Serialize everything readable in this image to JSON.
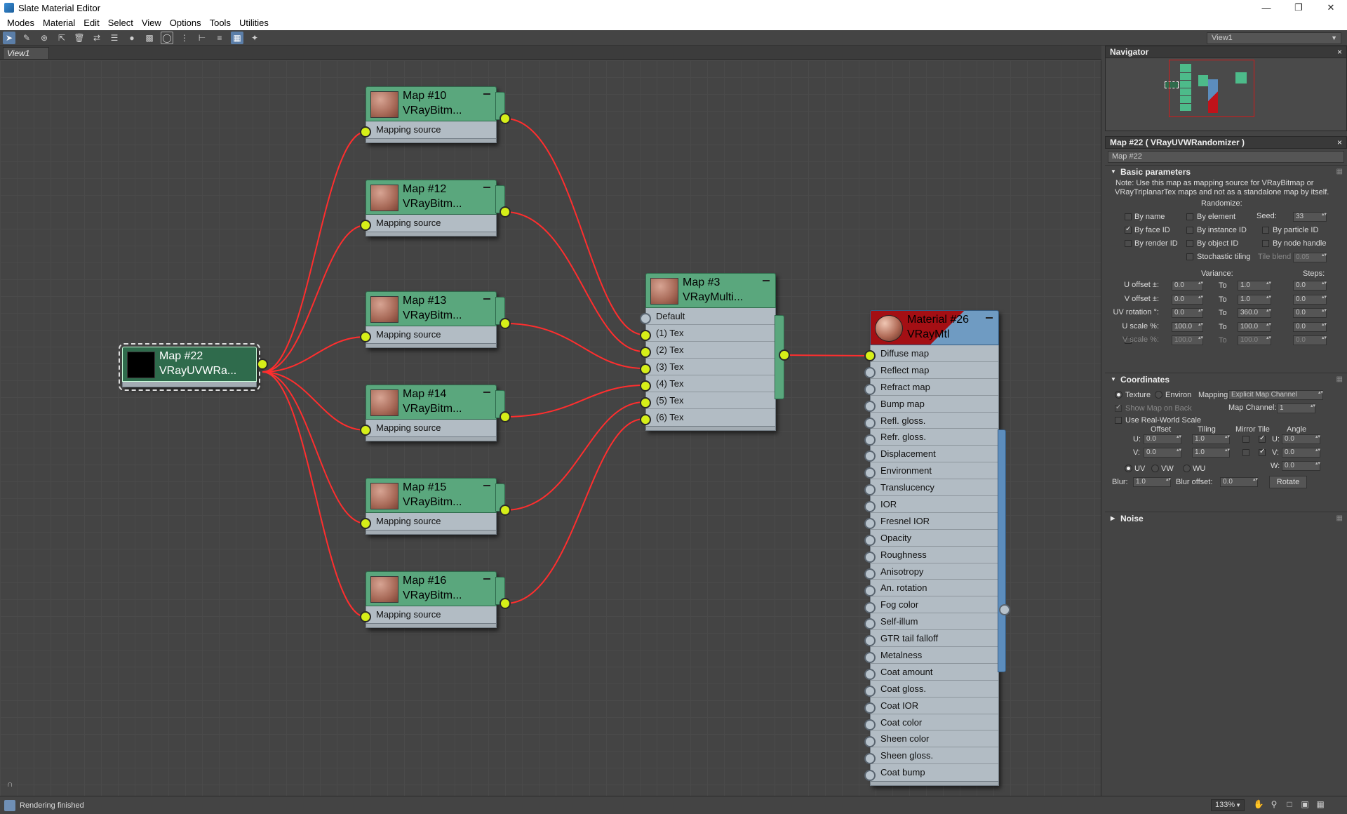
{
  "app": {
    "title": "Slate Material Editor"
  },
  "menu": [
    "Modes",
    "Material",
    "Edit",
    "Select",
    "View",
    "Options",
    "Tools",
    "Utilities"
  ],
  "view_select": "View1",
  "view_tab": "View1",
  "nodes": {
    "map22": {
      "name": "Map #22",
      "type": "VRayUVWRa...",
      "slots": []
    },
    "map10": {
      "name": "Map #10",
      "type": "VRayBitm...",
      "slots": [
        "Mapping source"
      ]
    },
    "map12": {
      "name": "Map #12",
      "type": "VRayBitm...",
      "slots": [
        "Mapping source"
      ]
    },
    "map13": {
      "name": "Map #13",
      "type": "VRayBitm...",
      "slots": [
        "Mapping source"
      ]
    },
    "map14": {
      "name": "Map #14",
      "type": "VRayBitm...",
      "slots": [
        "Mapping source"
      ]
    },
    "map15": {
      "name": "Map #15",
      "type": "VRayBitm...",
      "slots": [
        "Mapping source"
      ]
    },
    "map16": {
      "name": "Map #16",
      "type": "VRayBitm...",
      "slots": [
        "Mapping source"
      ]
    },
    "map3": {
      "name": "Map #3",
      "type": "VRayMulti...",
      "slots": [
        "Default",
        "(1) Tex",
        "(2) Tex",
        "(3) Tex",
        "(4) Tex",
        "(5) Tex",
        "(6) Tex"
      ]
    },
    "mat26": {
      "name": "Material #26",
      "type": "VRayMtl",
      "slots": [
        "Diffuse map",
        "Reflect map",
        "Refract map",
        "Bump map",
        "Refl. gloss.",
        "Refr. gloss.",
        "Displacement",
        "Environment",
        "Translucency",
        "IOR",
        "Fresnel IOR",
        "Opacity",
        "Roughness",
        "Anisotropy",
        "An. rotation",
        "Fog color",
        "Self-illum",
        "GTR tail falloff",
        "Metalness",
        "Coat amount",
        "Coat gloss.",
        "Coat IOR",
        "Coat color",
        "Sheen color",
        "Sheen gloss.",
        "Coat bump"
      ]
    }
  },
  "navigator": {
    "title": "Navigator"
  },
  "params": {
    "header": "Map #22  ( VRayUVWRandomizer )",
    "name_field": "Map #22",
    "basic_title": "Basic parameters",
    "note1": "Note: Use this map as mapping source for VRayBitmap or",
    "note2": "VRayTriplanarTex maps and not as a standalone map by itself.",
    "randomize": "Randomize:",
    "by_name": "By name",
    "by_element": "By element",
    "seed_label": "Seed:",
    "seed": "33",
    "by_face": "By face ID",
    "by_instance": "By instance ID",
    "by_particle": "By particle ID",
    "by_render": "By render ID",
    "by_object": "By object ID",
    "by_node": "By node handle",
    "stochastic": "Stochastic tiling",
    "tile_blend": "Tile blend",
    "tile_blend_val": "0.05",
    "variance": "Variance:",
    "steps": "Steps:",
    "to": "To",
    "rows": [
      {
        "label": "U offset ±:",
        "v": "0.0",
        "to": "1.0",
        "s": "0.0"
      },
      {
        "label": "V offset ±:",
        "v": "0.0",
        "to": "1.0",
        "s": "0.0"
      },
      {
        "label": "UV rotation °:",
        "v": "0.0",
        "to": "360.0",
        "s": "0.0"
      },
      {
        "label": "U scale %:",
        "v": "100.0",
        "to": "100.0",
        "s": "0.0"
      },
      {
        "label": "V scale %:",
        "v": "100.0",
        "to": "100.0",
        "s": "0.0"
      }
    ],
    "coords_title": "Coordinates",
    "texture": "Texture",
    "environ": "Environ",
    "mapping_label": "Mapping:",
    "mapping_val": "Explicit Map Channel",
    "show_map": "Show Map on Back",
    "map_channel_label": "Map Channel:",
    "map_channel": "1",
    "real_world": "Use Real-World Scale",
    "offset": "Offset",
    "tiling": "Tiling",
    "mirror_tile": "Mirror Tile",
    "angle": "Angle",
    "u": "U:",
    "v": "V:",
    "w": "W:",
    "u_off": "0.0",
    "u_til": "1.0",
    "u_ang": "0.0",
    "v_off": "0.0",
    "v_til": "1.0",
    "v_ang": "0.0",
    "w_ang": "0.0",
    "uv": "UV",
    "vw": "VW",
    "wu": "WU",
    "blur": "Blur:",
    "blur_val": "1.0",
    "blur_off": "Blur offset:",
    "blur_off_val": "0.0",
    "rotate": "Rotate",
    "noise_title": "Noise"
  },
  "status": {
    "text": "Rendering finished",
    "zoom": "133%"
  },
  "colors": {
    "wire": "#ff2e2e",
    "socket": "#d6ef18",
    "map_header": "#5aa77d",
    "mtl_header": "#6f9bc2",
    "canvas": "#444444"
  }
}
